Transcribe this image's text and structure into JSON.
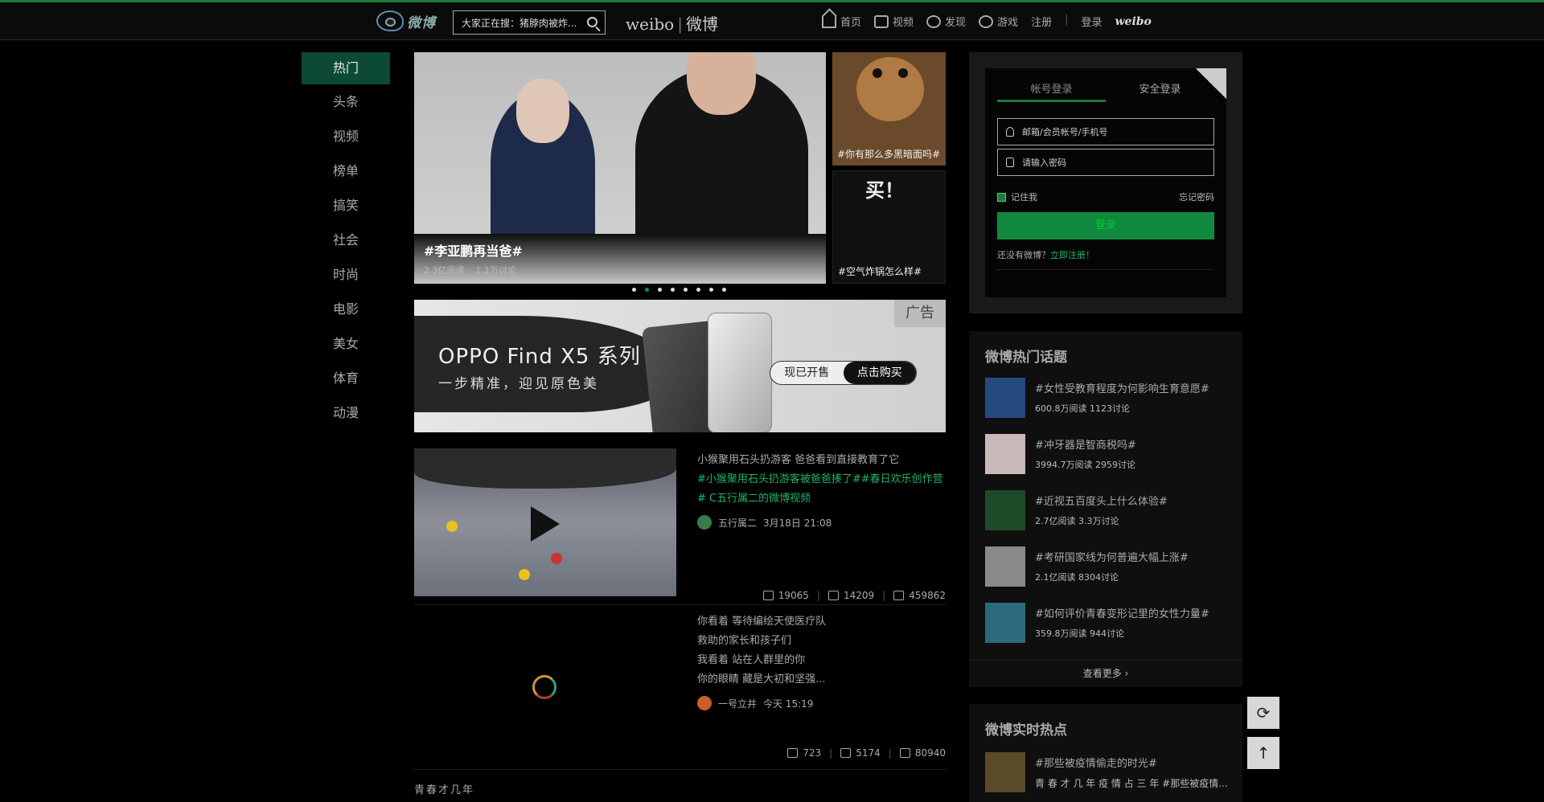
{
  "header": {
    "logo_text": "微博",
    "search_query": "大家正在搜：猪脖肉被炸...",
    "brand": "weibo",
    "brand_cn": "微博",
    "nav": [
      {
        "label": "首页",
        "icon": "home-icon"
      },
      {
        "label": "视频",
        "icon": "video-icon"
      },
      {
        "label": "发现",
        "icon": "compass-icon"
      },
      {
        "label": "游戏",
        "icon": "game-icon"
      }
    ],
    "register": "注册",
    "login": "登录",
    "weibo_mark": "weibo"
  },
  "leftnav": {
    "items": [
      "热门",
      "头条",
      "视频",
      "榜单",
      "搞笑",
      "社会",
      "时尚",
      "电影",
      "美女",
      "体育",
      "动漫"
    ],
    "active_index": 0
  },
  "carousel": {
    "main_title": "#李亚鹏再当爸#",
    "main_meta_reads": "2.3亿阅读",
    "main_meta_discuss": "1.1万讨论",
    "thumb_top_caption": "#你有那么多黑暗面吗#",
    "thumb_bottom_caption": "#空气炸锅怎么样#",
    "thumb_bottom_buy": "买！",
    "dots": 8,
    "active_dot": 1
  },
  "ad": {
    "title": "OPPO Find X5 系列",
    "subtitle": "一步精准，迎见原色美",
    "badge": "广告",
    "btn_left": "现已开售",
    "btn_right": "点击购买"
  },
  "feed": [
    {
      "text": "小猴聚用石头扔游客 爸爸看到直接教育了它",
      "tags": "#小猴聚用石头扔游客被爸爸揍了##春日欢乐创作营# C五行属二的微博视频",
      "author": "五行属二",
      "time": "3月18日 21:08",
      "reposts": "19065",
      "comments": "14209",
      "likes": "459862"
    },
    {
      "lines": [
        "你看着 等待编绘天使医疗队",
        "救助的家长和孩子们",
        "我看着 站在人群里的你",
        "你的眼睛 藏是大初和坚强..."
      ],
      "author": "一号立井",
      "time": "今天 15:19",
      "reposts": "723",
      "comments": "5174",
      "likes": "80940"
    }
  ],
  "section_footer": "青春才几年",
  "login": {
    "tab_account": "帐号登录",
    "tab_secure": "安全登录",
    "username_placeholder": "邮箱/会员帐号/手机号",
    "password_placeholder": "请输入密码",
    "remember": "记住我",
    "forgot": "忘记密码",
    "button": "登录",
    "no_account": "还没有微博？",
    "register_link": "立即注册！"
  },
  "hot": {
    "title": "微博热门话题",
    "items": [
      {
        "title": "#女性受教育程度为何影响生育意愿#",
        "meta": "600.8万阅读 1123讨论",
        "color": "#254a80"
      },
      {
        "title": "#冲牙器是智商税吗#",
        "meta": "3994.7万阅读 2959讨论",
        "color": "#c9b8b8"
      },
      {
        "title": "#近视五百度头上什么体验#",
        "meta": "2.7亿阅读 3.3万讨论",
        "color": "#1e4a2a"
      },
      {
        "title": "#考研国家线为何普遍大幅上涨#",
        "meta": "2.1亿阅读 8304讨论",
        "color": "#8a8a8a"
      },
      {
        "title": "#如何评价青春变形记里的女性力量#",
        "meta": "359.8万阅读 944讨论",
        "color": "#2a6a7a"
      }
    ],
    "more": "查看更多 ›"
  },
  "live": {
    "title": "微博实时热点",
    "item_title": "#那些被疫情偷走的时光#",
    "item_sub": "青 春 才 几 年 疫 情 占 三 年 #那些被疫情..."
  },
  "colors": {
    "accent": "#1b7a3c",
    "link": "#1fb36b",
    "background": "#000000"
  }
}
